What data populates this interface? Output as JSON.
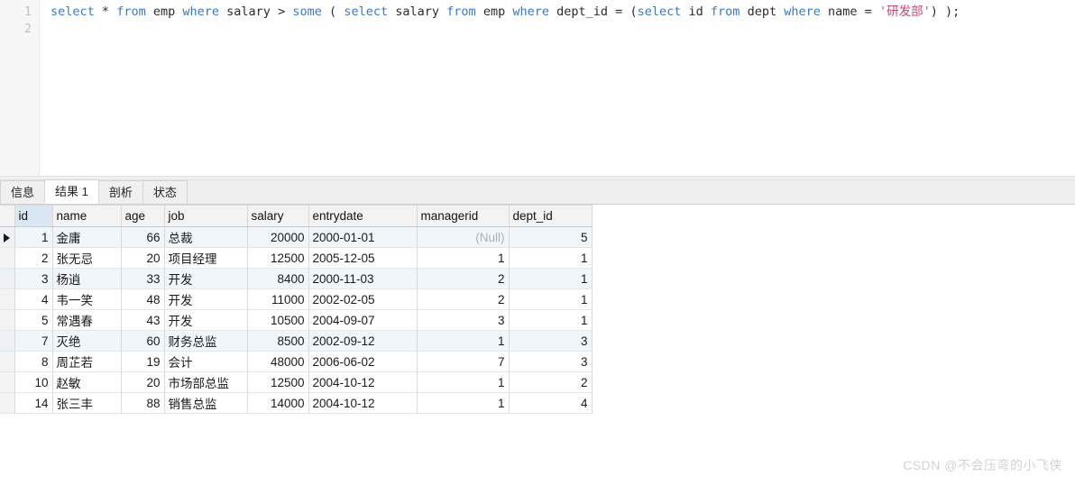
{
  "editor": {
    "line_numbers": [
      "1",
      "2"
    ],
    "sql_tokens": [
      {
        "t": "select",
        "k": "kw"
      },
      {
        "t": " ",
        "k": "op"
      },
      {
        "t": "*",
        "k": "op"
      },
      {
        "t": " ",
        "k": "op"
      },
      {
        "t": "from",
        "k": "kw"
      },
      {
        "t": " ",
        "k": "op"
      },
      {
        "t": "emp",
        "k": "id"
      },
      {
        "t": " ",
        "k": "op"
      },
      {
        "t": "where",
        "k": "kw"
      },
      {
        "t": " ",
        "k": "op"
      },
      {
        "t": "salary",
        "k": "id"
      },
      {
        "t": " ",
        "k": "op"
      },
      {
        "t": ">",
        "k": "op"
      },
      {
        "t": " ",
        "k": "op"
      },
      {
        "t": "some",
        "k": "kw"
      },
      {
        "t": " ",
        "k": "op"
      },
      {
        "t": "(",
        "k": "op"
      },
      {
        "t": " ",
        "k": "op"
      },
      {
        "t": "select",
        "k": "kw"
      },
      {
        "t": " ",
        "k": "op"
      },
      {
        "t": "salary",
        "k": "id"
      },
      {
        "t": " ",
        "k": "op"
      },
      {
        "t": "from",
        "k": "kw"
      },
      {
        "t": " ",
        "k": "op"
      },
      {
        "t": "emp",
        "k": "id"
      },
      {
        "t": " ",
        "k": "op"
      },
      {
        "t": "where",
        "k": "kw"
      },
      {
        "t": " ",
        "k": "op"
      },
      {
        "t": "dept_id",
        "k": "id"
      },
      {
        "t": " ",
        "k": "op"
      },
      {
        "t": "=",
        "k": "op"
      },
      {
        "t": " ",
        "k": "op"
      },
      {
        "t": "(",
        "k": "op"
      },
      {
        "t": "select",
        "k": "kw"
      },
      {
        "t": " ",
        "k": "op"
      },
      {
        "t": "id",
        "k": "id"
      },
      {
        "t": " ",
        "k": "op"
      },
      {
        "t": "from",
        "k": "kw"
      },
      {
        "t": " ",
        "k": "op"
      },
      {
        "t": "dept",
        "k": "id"
      },
      {
        "t": " ",
        "k": "op"
      },
      {
        "t": "where",
        "k": "kw"
      },
      {
        "t": " ",
        "k": "op"
      },
      {
        "t": "name",
        "k": "id"
      },
      {
        "t": " ",
        "k": "op"
      },
      {
        "t": "=",
        "k": "op"
      },
      {
        "t": " ",
        "k": "op"
      },
      {
        "t": "'研发部'",
        "k": "str"
      },
      {
        "t": ")",
        "k": "op"
      },
      {
        "t": " ",
        "k": "op"
      },
      {
        "t": ")",
        "k": "op"
      },
      {
        "t": ";",
        "k": "op"
      }
    ],
    "sql_text": "select * from emp where salary > some ( select salary from emp where dept_id = (select id from dept where name = '研发部') );"
  },
  "tabs": [
    {
      "label": "信息",
      "active": false
    },
    {
      "label": "结果 1",
      "active": true
    },
    {
      "label": "剖析",
      "active": false
    },
    {
      "label": "状态",
      "active": false
    }
  ],
  "grid": {
    "columns": [
      {
        "key": "id",
        "label": "id",
        "align": "num",
        "selected": true
      },
      {
        "key": "name",
        "label": "name",
        "align": "txt",
        "selected": false
      },
      {
        "key": "age",
        "label": "age",
        "align": "num",
        "selected": false
      },
      {
        "key": "job",
        "label": "job",
        "align": "txt",
        "selected": false
      },
      {
        "key": "salary",
        "label": "salary",
        "align": "num",
        "selected": false
      },
      {
        "key": "entrydate",
        "label": "entrydate",
        "align": "txt",
        "selected": false
      },
      {
        "key": "managerid",
        "label": "managerid",
        "align": "num",
        "selected": false
      },
      {
        "key": "dept_id",
        "label": "dept_id",
        "align": "num",
        "selected": false
      }
    ],
    "null_label": "(Null)",
    "current_row_index": 0,
    "rows": [
      {
        "id": "1",
        "name": "金庸",
        "age": "66",
        "job": "总裁",
        "salary": "20000",
        "entrydate": "2000-01-01",
        "managerid": null,
        "dept_id": "5"
      },
      {
        "id": "2",
        "name": "张无忌",
        "age": "20",
        "job": "项目经理",
        "salary": "12500",
        "entrydate": "2005-12-05",
        "managerid": "1",
        "dept_id": "1"
      },
      {
        "id": "3",
        "name": "杨逍",
        "age": "33",
        "job": "开发",
        "salary": "8400",
        "entrydate": "2000-11-03",
        "managerid": "2",
        "dept_id": "1"
      },
      {
        "id": "4",
        "name": "韦一笑",
        "age": "48",
        "job": "开发",
        "salary": "11000",
        "entrydate": "2002-02-05",
        "managerid": "2",
        "dept_id": "1"
      },
      {
        "id": "5",
        "name": "常遇春",
        "age": "43",
        "job": "开发",
        "salary": "10500",
        "entrydate": "2004-09-07",
        "managerid": "3",
        "dept_id": "1"
      },
      {
        "id": "7",
        "name": "灭绝",
        "age": "60",
        "job": "财务总监",
        "salary": "8500",
        "entrydate": "2002-09-12",
        "managerid": "1",
        "dept_id": "3"
      },
      {
        "id": "8",
        "name": "周芷若",
        "age": "19",
        "job": "会计",
        "salary": "48000",
        "entrydate": "2006-06-02",
        "managerid": "7",
        "dept_id": "3"
      },
      {
        "id": "10",
        "name": "赵敏",
        "age": "20",
        "job": "市场部总监",
        "salary": "12500",
        "entrydate": "2004-10-12",
        "managerid": "1",
        "dept_id": "2"
      },
      {
        "id": "14",
        "name": "张三丰",
        "age": "88",
        "job": "销售总监",
        "salary": "14000",
        "entrydate": "2004-10-12",
        "managerid": "1",
        "dept_id": "4"
      }
    ]
  },
  "watermark": {
    "text": "CSDN @不会压弯的小飞侠"
  },
  "colors": {
    "keyword": "#3b78c4",
    "string": "#d44070",
    "identifier": "#2b2b2b",
    "selected_header": "#dbe7f3",
    "alt_row": "#f1f6fb",
    "header_bg": "#f3f3f3",
    "watermark": "#d2d2d2"
  }
}
